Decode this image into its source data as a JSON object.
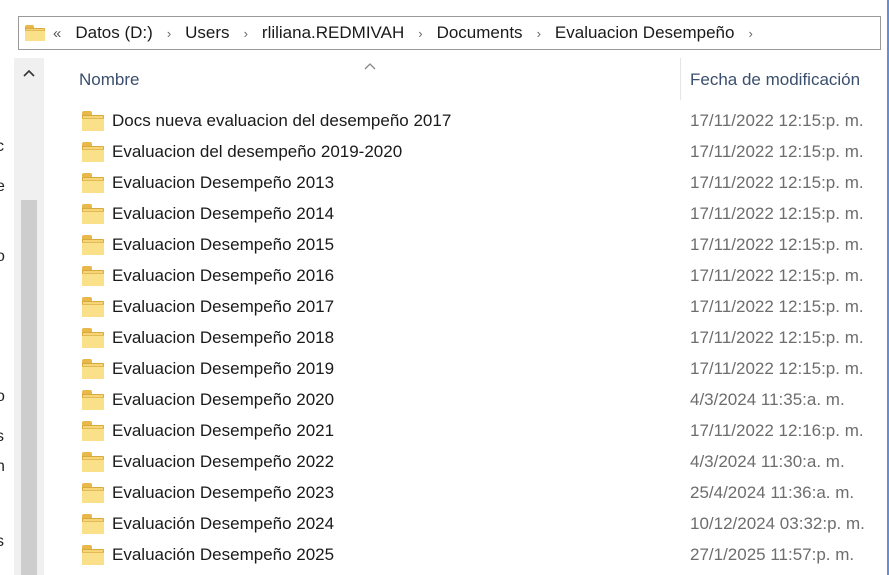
{
  "address_bar": {
    "overflow": "«",
    "crumbs": [
      "Datos (D:)",
      "Users",
      "rliliana.REDMIVAH",
      "Documents",
      "Evaluacion Desempeño"
    ],
    "separator": "›"
  },
  "columns": {
    "name": "Nombre",
    "date": "Fecha de modificación",
    "sort_indicator": "^"
  },
  "scrollbar": {
    "up_arrow": "^"
  },
  "nav_bleed": [
    "c",
    "e",
    "i",
    "o",
    "o",
    "s",
    "n",
    "s"
  ],
  "files": [
    {
      "name": "Docs nueva evaluacion del desempeño 2017",
      "date": "17/11/2022 12:15:p. m."
    },
    {
      "name": "Evaluacion del desempeño 2019-2020",
      "date": "17/11/2022 12:15:p. m."
    },
    {
      "name": "Evaluacion Desempeño 2013",
      "date": "17/11/2022 12:15:p. m."
    },
    {
      "name": "Evaluacion Desempeño 2014",
      "date": "17/11/2022 12:15:p. m."
    },
    {
      "name": "Evaluacion Desempeño 2015",
      "date": "17/11/2022 12:15:p. m."
    },
    {
      "name": "Evaluacion Desempeño 2016",
      "date": "17/11/2022 12:15:p. m."
    },
    {
      "name": "Evaluacion Desempeño 2017",
      "date": "17/11/2022 12:15:p. m."
    },
    {
      "name": "Evaluacion Desempeño 2018",
      "date": "17/11/2022 12:15:p. m."
    },
    {
      "name": "Evaluacion Desempeño 2019",
      "date": "17/11/2022 12:15:p. m."
    },
    {
      "name": "Evaluacion Desempeño 2020",
      "date": "4/3/2024 11:35:a. m."
    },
    {
      "name": "Evaluacion Desempeño 2021",
      "date": "17/11/2022 12:16:p. m."
    },
    {
      "name": "Evaluacion Desempeño 2022",
      "date": "4/3/2024 11:30:a. m."
    },
    {
      "name": "Evaluacion Desempeño 2023",
      "date": "25/4/2024 11:36:a. m."
    },
    {
      "name": "Evaluación Desempeño 2024",
      "date": "10/12/2024 03:32:p. m."
    },
    {
      "name": "Evaluación Desempeño 2025",
      "date": "27/1/2025 11:57:p. m."
    }
  ],
  "icons": {
    "folder": "folder-icon",
    "chevron": "chevron-right-icon",
    "sort": "sort-up-icon"
  },
  "colors": {
    "folder_yellow": "#f6d576",
    "header_text": "#3a4f6d",
    "date_text": "#6d6d6d"
  }
}
